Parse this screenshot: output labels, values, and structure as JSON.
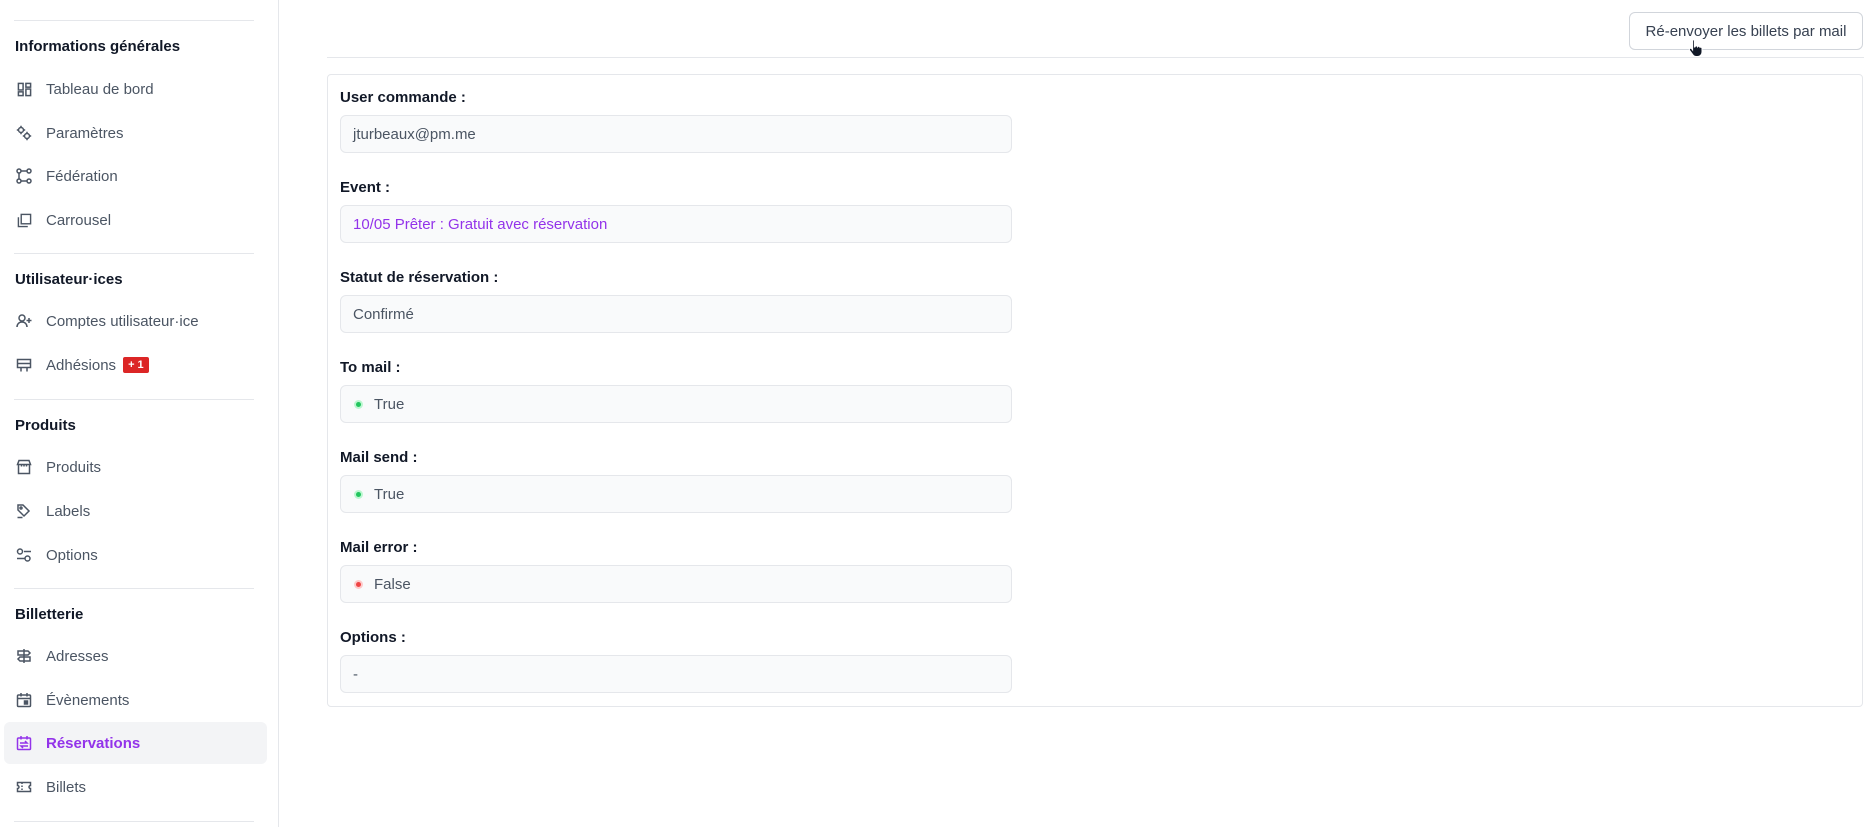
{
  "sidebar": {
    "sections": [
      {
        "title": "Informations générales"
      },
      {
        "title": "Utilisateur·ices"
      },
      {
        "title": "Produits"
      },
      {
        "title": "Billetterie"
      }
    ],
    "items": [
      {
        "label": "Tableau de bord",
        "icon": "dashboard-icon"
      },
      {
        "label": "Paramètres",
        "icon": "settings-icon"
      },
      {
        "label": "Fédération",
        "icon": "federation-icon"
      },
      {
        "label": "Carrousel",
        "icon": "carousel-icon"
      },
      {
        "label": "Comptes utilisateur·ice",
        "icon": "add-user-icon"
      },
      {
        "label": "Adhésions",
        "icon": "membership-icon",
        "badge": "+ 1"
      },
      {
        "label": "Produits",
        "icon": "store-icon"
      },
      {
        "label": "Labels",
        "icon": "tags-icon"
      },
      {
        "label": "Options",
        "icon": "options-icon"
      },
      {
        "label": "Adresses",
        "icon": "signpost-icon"
      },
      {
        "label": "Évènements",
        "icon": "calendar-icon"
      },
      {
        "label": "Réservations",
        "icon": "reservation-icon",
        "active": true
      },
      {
        "label": "Billets",
        "icon": "ticket-icon"
      }
    ]
  },
  "toolbar": {
    "resend_label": "Ré-envoyer les billets par mail"
  },
  "form": {
    "user": {
      "label": "User commande :",
      "value": "jturbeaux@pm.me"
    },
    "event": {
      "label": "Event :",
      "value": "10/05 Prêter : Gratuit avec réservation"
    },
    "status": {
      "label": "Statut de réservation :",
      "value": "Confirmé"
    },
    "to_mail": {
      "label": "To mail :",
      "value": "True"
    },
    "mail_send": {
      "label": "Mail send :",
      "value": "True"
    },
    "mail_error": {
      "label": "Mail error :",
      "value": "False"
    },
    "options": {
      "label": "Options :",
      "value": "-"
    }
  },
  "colors": {
    "accent": "#9333ea",
    "badge": "#dc2626",
    "true_dot": "#22c55e",
    "false_dot": "#ef4444"
  }
}
